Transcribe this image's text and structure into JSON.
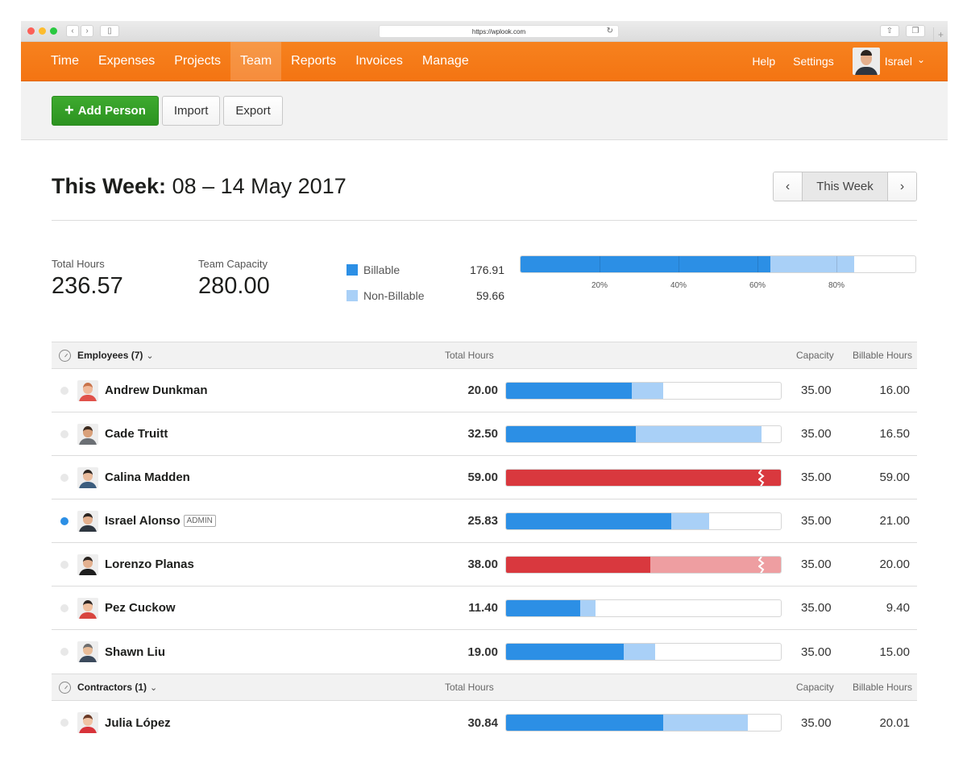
{
  "browser": {
    "url": "https://wplook.com",
    "icons": {
      "back": "chevron-left-icon",
      "forward": "chevron-right-icon",
      "sidebar": "sidebar-icon",
      "reload": "reload-icon",
      "share": "share-icon",
      "tabs": "tabs-icon",
      "new_tab": "plus-icon"
    }
  },
  "nav": {
    "items": [
      {
        "label": "Time",
        "active": false
      },
      {
        "label": "Expenses",
        "active": false
      },
      {
        "label": "Projects",
        "active": false
      },
      {
        "label": "Team",
        "active": true
      },
      {
        "label": "Reports",
        "active": false
      },
      {
        "label": "Invoices",
        "active": false
      },
      {
        "label": "Manage",
        "active": false
      }
    ],
    "help": "Help",
    "settings": "Settings",
    "user_name": "Israel",
    "user_chevron": "⌄"
  },
  "toolbar": {
    "add_person": "Add Person",
    "add_icon": "+",
    "import": "Import",
    "export": "Export"
  },
  "week": {
    "label": "This Week:",
    "range": "08 – 14 May 2017",
    "prev": "‹",
    "current": "This Week",
    "next": "›"
  },
  "summary": {
    "total_hours_label": "Total Hours",
    "total_hours": "236.57",
    "capacity_label": "Team Capacity",
    "capacity": "280.00",
    "billable_label": "Billable",
    "billable": "176.91",
    "nonbillable_label": "Non-Billable",
    "nonbillable": "59.66",
    "billable_fraction": 0.6318,
    "nonbillable_fraction": 0.2131,
    "ticks": [
      "20%",
      "40%",
      "60%",
      "80%"
    ],
    "tick_values": [
      0.2,
      0.4,
      0.6,
      0.8
    ]
  },
  "colors": {
    "orange": "#f47b16",
    "green": "#34a026",
    "billable": "#2c8fe5",
    "nonbillable": "#a9d0f7",
    "over": "#d9383e",
    "over_light": "#ee9ea1",
    "active_dot": "#2c8fe5"
  },
  "columns": {
    "total": "Total Hours",
    "capacity": "Capacity",
    "billable": "Billable Hours"
  },
  "groups": [
    {
      "title": "Employees (7)",
      "chevron": "⌄",
      "people": [
        {
          "name": "Andrew Dunkman",
          "admin": false,
          "active": false,
          "total": "20.00",
          "total_n": 20.0,
          "capacity": "35.00",
          "capacity_n": 35,
          "billable": "16.00",
          "billable_n": 16.0,
          "face": {
            "skin": "#f0b99a",
            "hair": "#c8734a",
            "shirt": "#e0514a"
          }
        },
        {
          "name": "Cade Truitt",
          "admin": false,
          "active": false,
          "total": "32.50",
          "total_n": 32.5,
          "capacity": "35.00",
          "capacity_n": 35,
          "billable": "16.50",
          "billable_n": 16.5,
          "face": {
            "skin": "#d9a07a",
            "hair": "#3b2a1f",
            "shirt": "#6b6f74"
          }
        },
        {
          "name": "Calina Madden",
          "admin": false,
          "active": false,
          "total": "59.00",
          "total_n": 59.0,
          "capacity": "35.00",
          "capacity_n": 35,
          "billable": "59.00",
          "billable_n": 59.0,
          "face": {
            "skin": "#e9bb9c",
            "hair": "#2d2520",
            "shirt": "#3c5d7e"
          }
        },
        {
          "name": "Israel Alonso",
          "admin": true,
          "admin_label": "ADMIN",
          "active": true,
          "total": "25.83",
          "total_n": 25.83,
          "capacity": "35.00",
          "capacity_n": 35,
          "billable": "21.00",
          "billable_n": 21.0,
          "face": {
            "skin": "#e4b08e",
            "hair": "#2b2420",
            "shirt": "#2e3640"
          }
        },
        {
          "name": "Lorenzo Planas",
          "admin": false,
          "active": false,
          "total": "38.00",
          "total_n": 38.0,
          "capacity": "35.00",
          "capacity_n": 35,
          "billable": "20.00",
          "billable_n": 20.0,
          "face": {
            "skin": "#e3b08f",
            "hair": "#2a2420",
            "shirt": "#1e1e1e"
          }
        },
        {
          "name": "Pez Cuckow",
          "admin": false,
          "active": false,
          "total": "11.40",
          "total_n": 11.4,
          "capacity": "35.00",
          "capacity_n": 35,
          "billable": "9.40",
          "billable_n": 9.4,
          "face": {
            "skin": "#f0c09f",
            "hair": "#2e2622",
            "shirt": "#d8453f"
          }
        },
        {
          "name": "Shawn Liu",
          "admin": false,
          "active": false,
          "total": "19.00",
          "total_n": 19.0,
          "capacity": "35.00",
          "capacity_n": 35,
          "billable": "15.00",
          "billable_n": 15.0,
          "face": {
            "skin": "#e8bc98",
            "hair": "#6e6e6e",
            "shirt": "#3b4a5c"
          }
        }
      ]
    },
    {
      "title": "Contractors (1)",
      "chevron": "⌄",
      "people": [
        {
          "name": "Julia López",
          "admin": false,
          "active": false,
          "total": "30.84",
          "total_n": 30.84,
          "capacity": "35.00",
          "capacity_n": 35,
          "billable": "20.01",
          "billable_n": 20.01,
          "face": {
            "skin": "#f0c3a4",
            "hair": "#6a3a26",
            "shirt": "#d8333a"
          }
        }
      ]
    }
  ]
}
